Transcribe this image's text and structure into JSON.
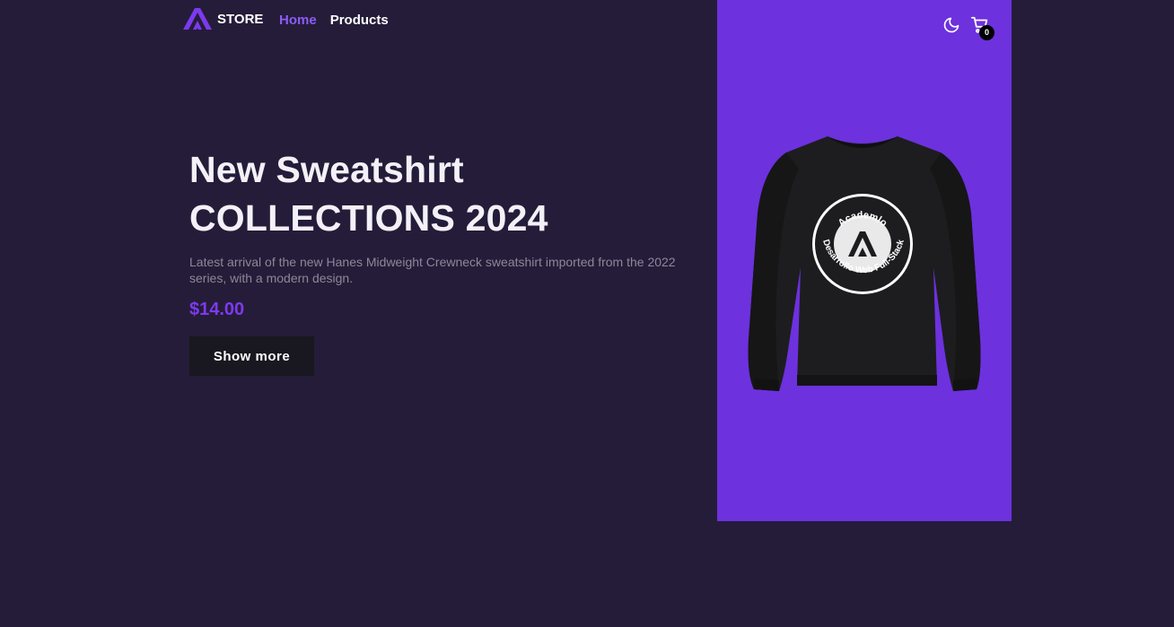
{
  "header": {
    "brand": "STORE",
    "nav": {
      "home": "Home",
      "products": "Products"
    },
    "icons": {
      "logo": "academlo-logo",
      "theme_toggle": "moon-icon",
      "cart": "cart-icon"
    },
    "cart_count": "0"
  },
  "hero": {
    "title_line1": "New Sweatshirt",
    "title_line2": "COLLECTIONS 2024",
    "description": "Latest arrival of the new Hanes Midweight Crewneck sweatshirt imported from the 2022 series, with a modern design.",
    "price": "$14.00",
    "button_label": "Show more"
  },
  "product_image": {
    "badge_text_top": "Academlo",
    "badge_text_bottom": "Desarrollo Web Full-Stack"
  },
  "colors": {
    "background": "#251c39",
    "accent": "#6d31de",
    "price": "#7c3aed",
    "button": "#19171f"
  }
}
